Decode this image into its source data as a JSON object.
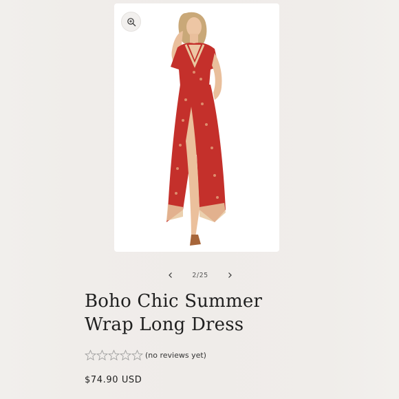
{
  "gallery": {
    "zoom_icon": "zoom-in-icon",
    "counter": "2/25",
    "prev_icon": "chevron-left-icon",
    "next_icon": "chevron-right-icon"
  },
  "product": {
    "title_line1": "Boho Chic Summer",
    "title_line2": "Wrap Long Dress",
    "rating": {
      "stars_total": 5,
      "stars_filled": 0,
      "review_text": "(no reviews yet)"
    },
    "price": "$74.90 USD"
  },
  "colors": {
    "background": "#efece9",
    "card": "#ffffff",
    "dress_red": "#c4302b",
    "text": "#1f1f1f",
    "star_outline": "#9a9a9a"
  }
}
